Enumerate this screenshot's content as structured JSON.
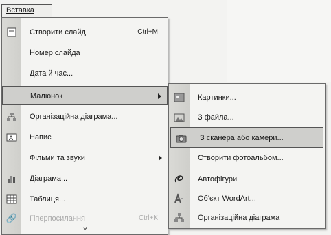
{
  "menubar": {
    "insert_label": "Вставка"
  },
  "insert_menu": {
    "items": [
      {
        "label": "Створити слайд",
        "shortcut": "Ctrl+M",
        "icon": "new-slide-icon"
      },
      {
        "label": "Номер слайда",
        "icon": ""
      },
      {
        "label": "Дата й час...",
        "icon": ""
      },
      {
        "label": "Малюнок",
        "icon": "",
        "has_submenu": true,
        "highlighted": true
      },
      {
        "label": "Організаційна діаграма...",
        "icon": "org-chart-icon"
      },
      {
        "label": "Напис",
        "icon": "text-box-icon"
      },
      {
        "label": "Фільми та звуки",
        "icon": "",
        "has_submenu": true
      },
      {
        "label": "Діаграма...",
        "icon": "chart-icon"
      },
      {
        "label": "Таблиця...",
        "icon": "table-icon"
      },
      {
        "label": "Гіперпосилання",
        "shortcut": "Ctrl+K",
        "icon": "hyperlink-icon",
        "disabled": true
      }
    ],
    "expand_glyph": "⌄"
  },
  "picture_submenu": {
    "items": [
      {
        "label": "Картинки...",
        "icon": "clip-art-icon"
      },
      {
        "label": "З файла...",
        "icon": "from-file-icon"
      },
      {
        "label": "З сканера або камери...",
        "icon": "scanner-camera-icon",
        "highlighted": true
      },
      {
        "label": "Створити фотоальбом...",
        "icon": ""
      },
      {
        "label": "Автофігури",
        "icon": "autoshapes-icon"
      },
      {
        "label": "Об'єкт WordArt...",
        "icon": "wordart-icon"
      },
      {
        "label": "Організаційна діаграма",
        "icon": "org-chart-icon"
      }
    ]
  }
}
